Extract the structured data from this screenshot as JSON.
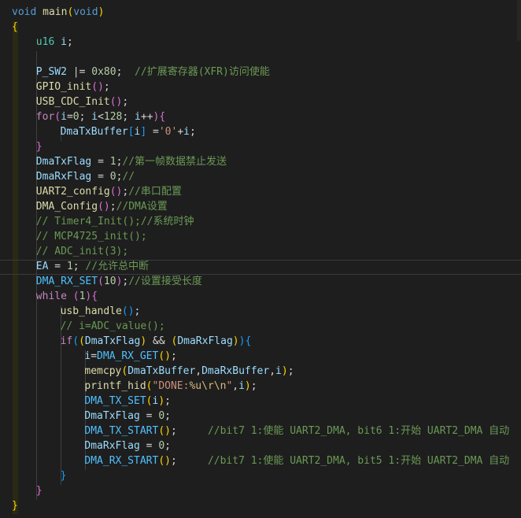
{
  "lines": [
    {
      "indent": 0,
      "tokens": [
        [
          "kw",
          "void"
        ],
        [
          "",
          " "
        ],
        [
          "fn",
          "main"
        ],
        [
          "p1",
          "("
        ],
        [
          "kw",
          "void"
        ],
        [
          "p1",
          ")"
        ]
      ]
    },
    {
      "indent": 0,
      "tokens": [
        [
          "p1",
          "{"
        ]
      ]
    },
    {
      "indent": 4,
      "tokens": [
        [
          "ty",
          "u16"
        ],
        [
          "",
          " "
        ],
        [
          "var",
          "i"
        ],
        [
          "",
          ";"
        ]
      ]
    },
    {
      "indent": 4,
      "tokens": []
    },
    {
      "indent": 4,
      "tokens": [
        [
          "var",
          "P_SW2"
        ],
        [
          "",
          " |= "
        ],
        [
          "num",
          "0x80"
        ],
        [
          "",
          ";  "
        ],
        [
          "cm",
          "//扩展寄存器(XFR)访问使能"
        ]
      ]
    },
    {
      "indent": 4,
      "tokens": [
        [
          "fn",
          "GPIO_init"
        ],
        [
          "p2",
          "()"
        ],
        [
          "",
          ";"
        ]
      ]
    },
    {
      "indent": 4,
      "tokens": [
        [
          "fn",
          "USB_CDC_Init"
        ],
        [
          "p2",
          "()"
        ],
        [
          "",
          ";"
        ]
      ]
    },
    {
      "indent": 4,
      "tokens": [
        [
          "ctl",
          "for"
        ],
        [
          "p2",
          "("
        ],
        [
          "var",
          "i"
        ],
        [
          "",
          "="
        ],
        [
          "num",
          "0"
        ],
        [
          "",
          "; "
        ],
        [
          "var",
          "i"
        ],
        [
          "",
          "<"
        ],
        [
          "num",
          "128"
        ],
        [
          "",
          "; "
        ],
        [
          "var",
          "i"
        ],
        [
          "",
          "++"
        ],
        [
          "p2",
          ")"
        ],
        [
          "p2",
          "{"
        ]
      ]
    },
    {
      "indent": 8,
      "tokens": [
        [
          "var",
          "DmaTxBuffer"
        ],
        [
          "p3",
          "["
        ],
        [
          "var",
          "i"
        ],
        [
          "p3",
          "]"
        ],
        [
          "",
          " ="
        ],
        [
          "str",
          "'0'"
        ],
        [
          "",
          "+"
        ],
        [
          "var",
          "i"
        ],
        [
          "",
          ";"
        ]
      ]
    },
    {
      "indent": 4,
      "tokens": [
        [
          "p2",
          "}"
        ]
      ]
    },
    {
      "indent": 4,
      "tokens": [
        [
          "var",
          "DmaTxFlag"
        ],
        [
          "",
          " = "
        ],
        [
          "num",
          "1"
        ],
        [
          "",
          ";"
        ],
        [
          "cm",
          "//第一帧数据禁止发送"
        ]
      ]
    },
    {
      "indent": 4,
      "tokens": [
        [
          "var",
          "DmaRxFlag"
        ],
        [
          "",
          " = "
        ],
        [
          "num",
          "0"
        ],
        [
          "",
          ";"
        ],
        [
          "cm",
          "//"
        ]
      ]
    },
    {
      "indent": 4,
      "tokens": [
        [
          "fn",
          "UART2_config"
        ],
        [
          "p2",
          "()"
        ],
        [
          "",
          ";"
        ],
        [
          "cm",
          "//串口配置"
        ]
      ]
    },
    {
      "indent": 4,
      "tokens": [
        [
          "fn",
          "DMA_Config"
        ],
        [
          "p2",
          "()"
        ],
        [
          "",
          ";"
        ],
        [
          "cm",
          "//DMA设置"
        ]
      ]
    },
    {
      "indent": 4,
      "tokens": [
        [
          "cm",
          "// Timer4_Init();//系统时钟"
        ]
      ]
    },
    {
      "indent": 4,
      "tokens": [
        [
          "cm",
          "// MCP4725_init();"
        ]
      ]
    },
    {
      "indent": 4,
      "tokens": [
        [
          "cm",
          "// ADC_init(3);"
        ]
      ]
    },
    {
      "indent": 4,
      "tokens": [
        [
          "var",
          "EA"
        ],
        [
          "",
          " = "
        ],
        [
          "num",
          "1"
        ],
        [
          "",
          "; "
        ],
        [
          "cm",
          "//允许总中断"
        ]
      ]
    },
    {
      "indent": 4,
      "tokens": [
        [
          "mac",
          "DMA_RX_SET"
        ],
        [
          "p2",
          "("
        ],
        [
          "num",
          "10"
        ],
        [
          "p2",
          ")"
        ],
        [
          "",
          ";"
        ],
        [
          "cm",
          "//设置接受长度"
        ]
      ]
    },
    {
      "indent": 4,
      "tokens": [
        [
          "ctl",
          "while"
        ],
        [
          "",
          " "
        ],
        [
          "p2",
          "("
        ],
        [
          "num",
          "1"
        ],
        [
          "p2",
          ")"
        ],
        [
          "p2",
          "{"
        ]
      ]
    },
    {
      "indent": 8,
      "tokens": [
        [
          "fn",
          "usb_handle"
        ],
        [
          "p3",
          "()"
        ],
        [
          "",
          ";"
        ]
      ]
    },
    {
      "indent": 8,
      "tokens": [
        [
          "cm",
          "// i=ADC_value();"
        ]
      ]
    },
    {
      "indent": 8,
      "tokens": [
        [
          "ctl",
          "if"
        ],
        [
          "p3",
          "("
        ],
        [
          "p1",
          "("
        ],
        [
          "var",
          "DmaTxFlag"
        ],
        [
          "p1",
          ")"
        ],
        [
          "",
          " && "
        ],
        [
          "p1",
          "("
        ],
        [
          "var",
          "DmaRxFlag"
        ],
        [
          "p1",
          ")"
        ],
        [
          "p3",
          ")"
        ],
        [
          "p3",
          "{"
        ]
      ]
    },
    {
      "indent": 12,
      "tokens": [
        [
          "var",
          "i"
        ],
        [
          "",
          "="
        ],
        [
          "mac",
          "DMA_RX_GET"
        ],
        [
          "p1",
          "()"
        ],
        [
          "",
          ";"
        ]
      ]
    },
    {
      "indent": 12,
      "tokens": [
        [
          "fn",
          "memcpy"
        ],
        [
          "p1",
          "("
        ],
        [
          "var",
          "DmaTxBuffer"
        ],
        [
          "",
          ","
        ],
        [
          "var",
          "DmaRxBuffer"
        ],
        [
          "",
          ","
        ],
        [
          "var",
          "i"
        ],
        [
          "p1",
          ")"
        ],
        [
          "",
          ";"
        ]
      ]
    },
    {
      "indent": 12,
      "tokens": [
        [
          "fn",
          "printf_hid"
        ],
        [
          "p1",
          "("
        ],
        [
          "str",
          "\"DONE:"
        ],
        [
          "esc",
          "%u\\r\\n"
        ],
        [
          "str",
          "\""
        ],
        [
          "",
          ","
        ],
        [
          "var",
          "i"
        ],
        [
          "p1",
          ")"
        ],
        [
          "",
          ";"
        ]
      ]
    },
    {
      "indent": 12,
      "tokens": [
        [
          "mac",
          "DMA_TX_SET"
        ],
        [
          "p1",
          "("
        ],
        [
          "var",
          "i"
        ],
        [
          "p1",
          ")"
        ],
        [
          "",
          ";"
        ]
      ]
    },
    {
      "indent": 12,
      "tokens": [
        [
          "var",
          "DmaTxFlag"
        ],
        [
          "",
          " = "
        ],
        [
          "num",
          "0"
        ],
        [
          "",
          ";"
        ]
      ]
    },
    {
      "indent": 12,
      "tokens": [
        [
          "mac",
          "DMA_TX_START"
        ],
        [
          "p1",
          "()"
        ],
        [
          "",
          ";     "
        ],
        [
          "cm",
          "//bit7 1:使能 UART2_DMA, bit6 1:开始 UART2_DMA 自动"
        ]
      ]
    },
    {
      "indent": 12,
      "tokens": [
        [
          "var",
          "DmaRxFlag"
        ],
        [
          "",
          " = "
        ],
        [
          "num",
          "0"
        ],
        [
          "",
          ";"
        ]
      ]
    },
    {
      "indent": 12,
      "tokens": [
        [
          "mac",
          "DMA_RX_START"
        ],
        [
          "p1",
          "()"
        ],
        [
          "",
          ";     "
        ],
        [
          "cm",
          "//bit7 1:使能 UART2_DMA, bit5 1:开始 UART2_DMA 自动"
        ]
      ]
    },
    {
      "indent": 8,
      "tokens": [
        [
          "p3",
          "}"
        ]
      ]
    },
    {
      "indent": 4,
      "tokens": [
        [
          "p2",
          "}"
        ]
      ]
    },
    {
      "indent": 0,
      "tokens": [
        [
          "p1",
          "}"
        ]
      ]
    }
  ],
  "colors": {
    "background": "#1e1e1e",
    "keyword": "#569cd6",
    "control": "#c586c0",
    "type": "#4ec9b0",
    "function": "#dcdcaa",
    "variable": "#9cdcfe",
    "number": "#b5cea8",
    "string": "#ce9178",
    "comment": "#6a9955",
    "macro": "#4fc1ff"
  }
}
